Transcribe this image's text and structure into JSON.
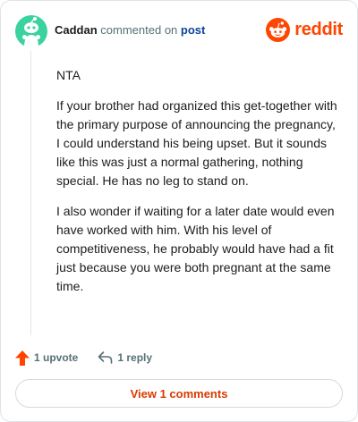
{
  "header": {
    "username": "Caddan",
    "action_text": "commented on",
    "post_link": "post",
    "brand_wordmark": "reddit",
    "brand_color": "#ff4500"
  },
  "comment": {
    "paragraphs": [
      "NTA",
      "If your brother had organized this get-together with the primary purpose of announcing the pregnancy, I could understand his being upset. But it sounds like this was just a normal gathering, nothing special. He has no leg to stand on.",
      "I also wonder if waiting for a later date would even have worked with him. With his level of competitiveness, he probably would have had a fit just because you were both pregnant at the same time."
    ]
  },
  "actions": {
    "upvote_label": "1 upvote",
    "reply_label": "1 reply",
    "upvote_icon": "upvote-arrow-icon",
    "reply_icon": "reply-arrow-icon",
    "upvote_color": "#ff4500"
  },
  "footer": {
    "view_comments_label": "View 1 comments",
    "accent": "#d93a00"
  },
  "avatar": {
    "icon": "snoo-avatar-icon",
    "background": "#3ad29f"
  }
}
